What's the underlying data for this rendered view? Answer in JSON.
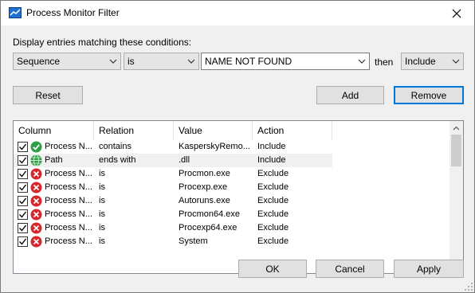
{
  "window": {
    "title": "Process Monitor Filter"
  },
  "conditions_label": "Display entries matching these conditions:",
  "filter": {
    "column_value": "Sequence",
    "relation_value": "is",
    "value_value": "NAME NOT FOUND",
    "then_label": "then",
    "action_value": "Include"
  },
  "buttons": {
    "reset": "Reset",
    "add": "Add",
    "remove": "Remove",
    "ok": "OK",
    "cancel": "Cancel",
    "apply": "Apply"
  },
  "list": {
    "headers": [
      "Column",
      "Relation",
      "Value",
      "Action"
    ],
    "rows": [
      {
        "checked": true,
        "icon": "green-check-icon",
        "column": "Process N...",
        "relation": "contains",
        "value": "KasperskyRemo...",
        "action": "Include"
      },
      {
        "checked": true,
        "icon": "green-globe-icon",
        "column": "Path",
        "relation": "ends with",
        "value": ".dll",
        "action": "Include"
      },
      {
        "checked": true,
        "icon": "red-x-icon",
        "column": "Process N...",
        "relation": "is",
        "value": "Procmon.exe",
        "action": "Exclude"
      },
      {
        "checked": true,
        "icon": "red-x-icon",
        "column": "Process N...",
        "relation": "is",
        "value": "Procexp.exe",
        "action": "Exclude"
      },
      {
        "checked": true,
        "icon": "red-x-icon",
        "column": "Process N...",
        "relation": "is",
        "value": "Autoruns.exe",
        "action": "Exclude"
      },
      {
        "checked": true,
        "icon": "red-x-icon",
        "column": "Process N...",
        "relation": "is",
        "value": "Procmon64.exe",
        "action": "Exclude"
      },
      {
        "checked": true,
        "icon": "red-x-icon",
        "column": "Process N...",
        "relation": "is",
        "value": "Procexp64.exe",
        "action": "Exclude"
      },
      {
        "checked": true,
        "icon": "red-x-icon",
        "column": "Process N...",
        "relation": "is",
        "value": "System",
        "action": "Exclude"
      }
    ]
  },
  "colors": {
    "accent": "#0078d7",
    "include_green": "#2ea043",
    "exclude_red": "#d9262b"
  }
}
